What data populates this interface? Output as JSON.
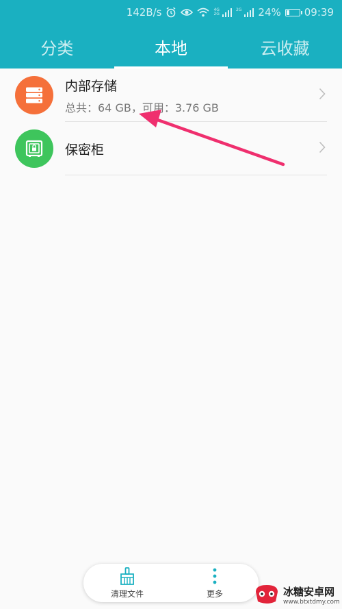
{
  "status_bar": {
    "speed": "142B/s",
    "net1": [
      "4G",
      "2G"
    ],
    "net2": "2G",
    "battery": "24%",
    "time": "09:39"
  },
  "tabs": [
    {
      "label": "分类",
      "active": false
    },
    {
      "label": "本地",
      "active": true
    },
    {
      "label": "云收藏",
      "active": false
    }
  ],
  "list": {
    "items": [
      {
        "title": "内部存储",
        "subtitle": "总共：64 GB，可用：3.76 GB",
        "icon": "storage-icon",
        "color": "#f5703a"
      },
      {
        "title": "保密柜",
        "icon": "safe-icon",
        "color": "#3ec55c"
      }
    ]
  },
  "bottom_bar": {
    "clean_label": "清理文件",
    "more_label": "更多"
  },
  "watermark": {
    "name": "冰糖安卓网",
    "url": "www.btxtdmy.com"
  },
  "colors": {
    "accent": "#1ab0c1",
    "arrow": "#ef2f6e"
  }
}
